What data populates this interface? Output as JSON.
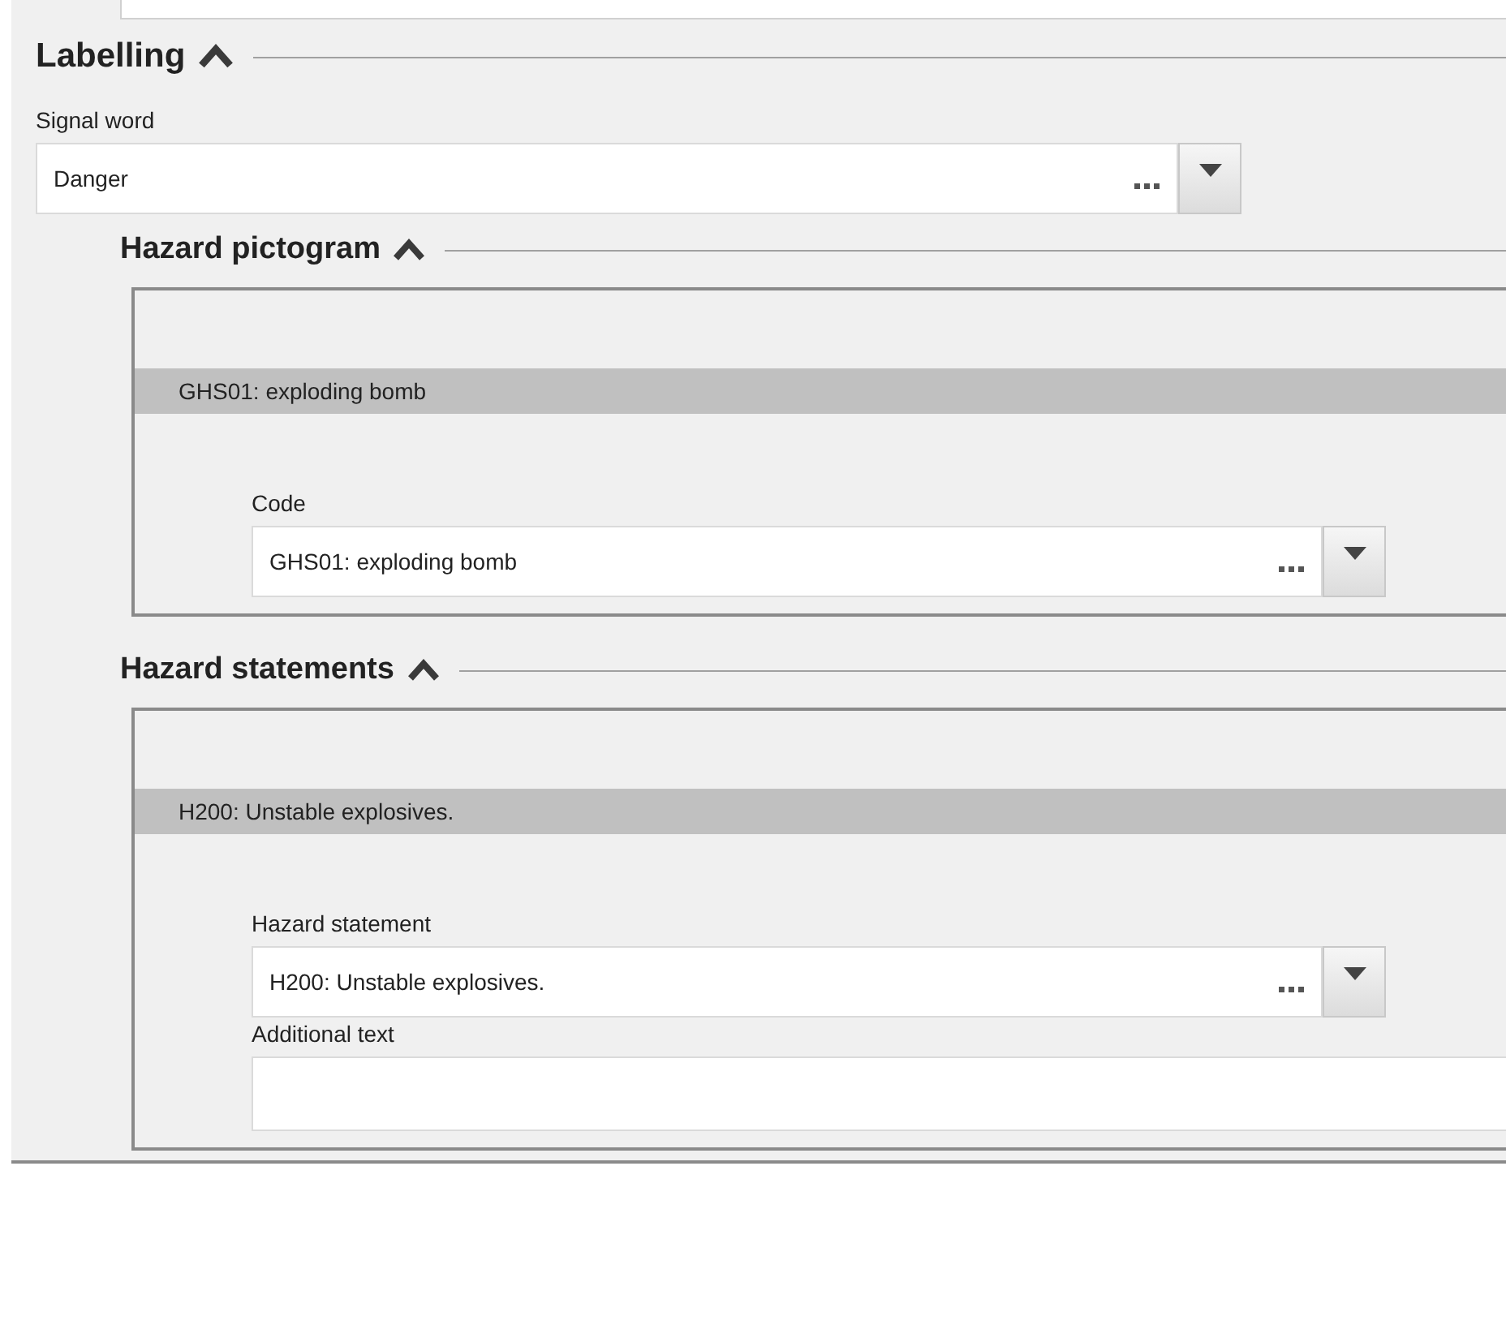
{
  "labelling": {
    "title": "Labelling",
    "expanded": true,
    "signal_word": {
      "label": "Signal word",
      "value": "Danger"
    },
    "hazard_pictogram": {
      "title": "Hazard pictogram",
      "expanded": true,
      "items": [
        {
          "header": "GHS01: exploding bomb",
          "fields": [
            {
              "kind": "picklist",
              "label": "Code",
              "value": "GHS01: exploding bomb"
            }
          ]
        }
      ]
    },
    "hazard_statements": {
      "title": "Hazard statements",
      "expanded": true,
      "items": [
        {
          "header": "H200: Unstable explosives.",
          "fields": [
            {
              "kind": "picklist",
              "label": "Hazard statement",
              "value": "H200: Unstable explosives."
            },
            {
              "kind": "text",
              "label": "Additional text"
            }
          ]
        }
      ]
    }
  }
}
